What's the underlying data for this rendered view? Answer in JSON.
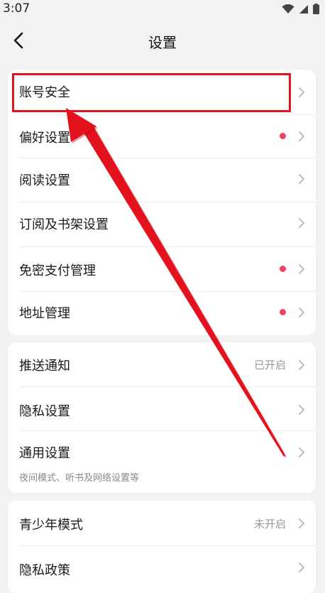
{
  "status": {
    "time": "3:07"
  },
  "header": {
    "title": "设置",
    "back_icon": "chevron-left-icon"
  },
  "group1": {
    "items": [
      {
        "label": "账号安全"
      },
      {
        "label": "偏好设置",
        "badge": "red-dot"
      },
      {
        "label": "阅读设置"
      },
      {
        "label": "订阅及书架设置"
      },
      {
        "label": "免密支付管理",
        "badge": "red-dot"
      },
      {
        "label": "地址管理",
        "badge": "red-dot"
      }
    ]
  },
  "group2": {
    "items": [
      {
        "label": "推送通知",
        "value": "已开启"
      },
      {
        "label": "隐私设置"
      },
      {
        "label": "通用设置",
        "subtitle": "夜间模式、听书及网络设置等"
      }
    ]
  },
  "group3": {
    "items": [
      {
        "label": "青少年模式",
        "value": "未开启"
      },
      {
        "label": "隐私政策"
      }
    ]
  },
  "colors": {
    "accent_dot": "#f0435f",
    "annotation": "#e0161f",
    "background": "#f2f2f2"
  }
}
